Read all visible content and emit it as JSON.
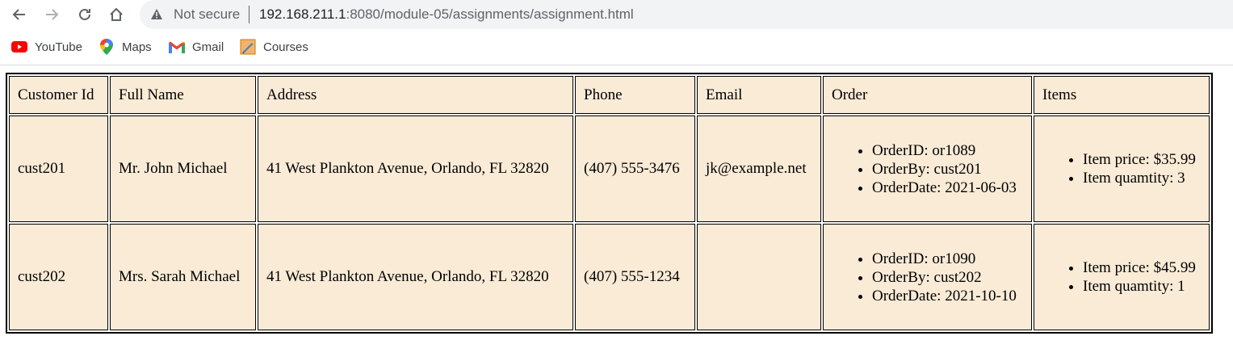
{
  "browser": {
    "security_label": "Not secure",
    "url_host": "192.168.211.1",
    "url_rest": ":8080/module-05/assignments/assignment.html"
  },
  "bookmarks": [
    {
      "label": "YouTube",
      "icon": "youtube-icon"
    },
    {
      "label": "Maps",
      "icon": "maps-icon"
    },
    {
      "label": "Gmail",
      "icon": "gmail-icon"
    },
    {
      "label": "Courses",
      "icon": "courses-icon"
    }
  ],
  "table": {
    "headers": [
      "Customer Id",
      "Full Name",
      "Address",
      "Phone",
      "Email",
      "Order",
      "Items"
    ],
    "rows": [
      {
        "id": "cust201",
        "name": "Mr. John Michael",
        "address": "41 West Plankton Avenue, Orlando, FL 32820",
        "phone": "(407) 555-3476",
        "email": "jk@example.net",
        "order": [
          "OrderID: or1089",
          "OrderBy: cust201",
          "OrderDate: 2021-06-03"
        ],
        "items": [
          "Item price: $35.99",
          "Item quamtity: 3"
        ]
      },
      {
        "id": "cust202",
        "name": "Mrs. Sarah Michael",
        "address": "41 West Plankton Avenue, Orlando, FL 32820",
        "phone": "(407) 555-1234",
        "email": "",
        "order": [
          "OrderID: or1090",
          "OrderBy: cust202",
          "OrderDate: 2021-10-10"
        ],
        "items": [
          "Item price: $45.99",
          "Item quamtity: 1"
        ]
      }
    ]
  },
  "colors": {
    "cell_background": "#faebd7"
  }
}
